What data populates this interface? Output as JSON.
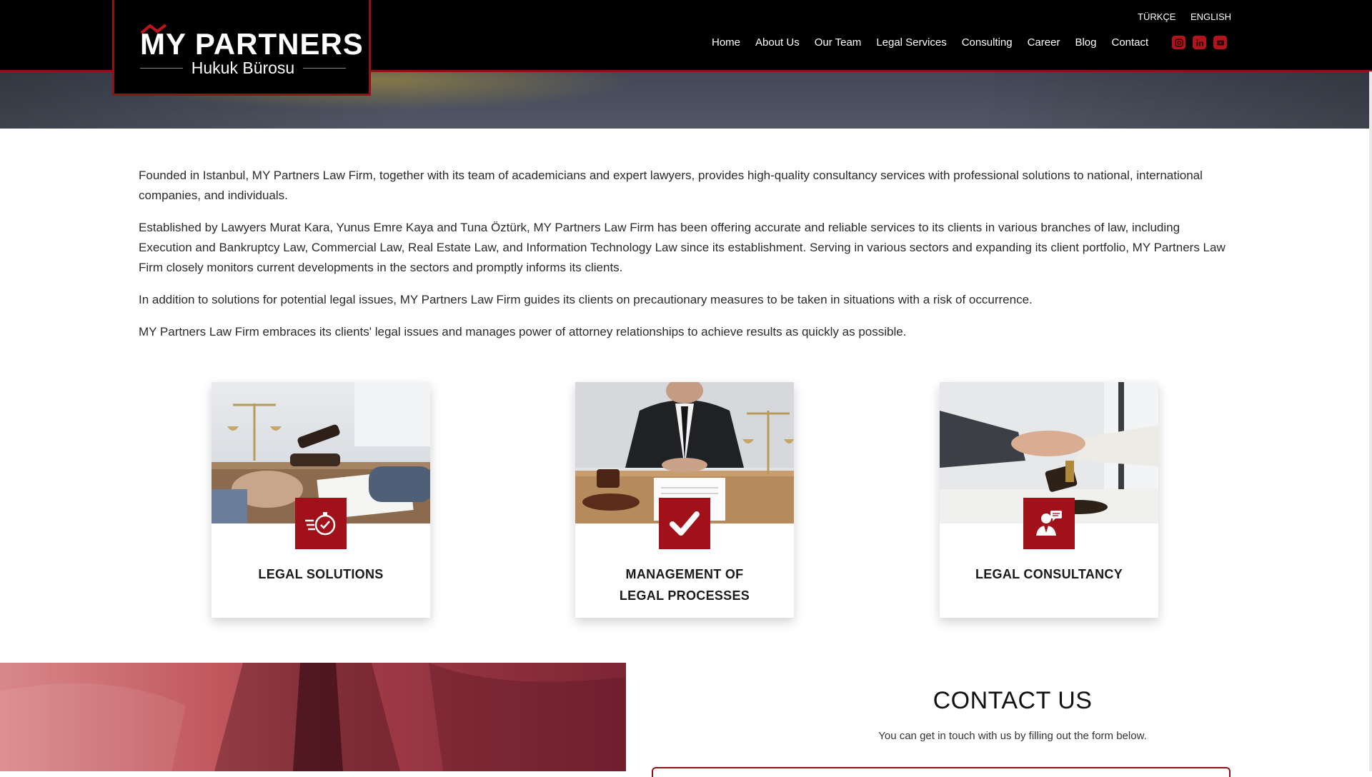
{
  "header": {
    "logo_main": "MY PARTNERS",
    "logo_sub": "Hukuk Bürosu",
    "languages": [
      "TÜRKÇE",
      "ENGLISH"
    ],
    "nav": [
      "Home",
      "About Us",
      "Our Team",
      "Legal Services",
      "Consulting",
      "Career",
      "Blog",
      "Contact"
    ],
    "socials": [
      "instagram-icon",
      "linkedin-icon",
      "youtube-icon"
    ],
    "accent_color": "#a1111a"
  },
  "intro": {
    "paragraphs": [
      "Founded in Istanbul, MY Partners Law Firm, together with its team of academicians and expert lawyers, provides high-quality consultancy services with professional solutions to national, international companies, and individuals.",
      "Established by Lawyers Murat Kara, Yunus Emre Kaya and Tuna Öztürk, MY Partners Law Firm has been offering accurate and reliable services to its clients in various branches of law, including Execution and Bankruptcy Law, Commercial Law, Real Estate Law, and Information Technology Law since its establishment. Serving in various sectors and expanding its client portfolio, MY Partners Law Firm closely monitors current developments in the sectors and promptly informs its clients.",
      "In addition to solutions for potential legal issues, MY Partners Law Firm guides its clients on precautionary measures to be taken in situations with a risk of occurrence.",
      "MY Partners Law Firm embraces its clients' legal issues and manages power of attorney relationships to achieve results as quickly as possible."
    ]
  },
  "cards": [
    {
      "title_lines": [
        "LEGAL SOLUTIONS"
      ],
      "icon": "stopwatch-icon"
    },
    {
      "title_lines": [
        "MANAGEMENT OF",
        "LEGAL PROCESSES"
      ],
      "icon": "checkmark-icon"
    },
    {
      "title_lines": [
        "LEGAL CONSULTANCY"
      ],
      "icon": "consultant-icon"
    }
  ],
  "contact": {
    "title": "CONTACT US",
    "subtitle": "You can get in touch with us by filling out the form below."
  }
}
